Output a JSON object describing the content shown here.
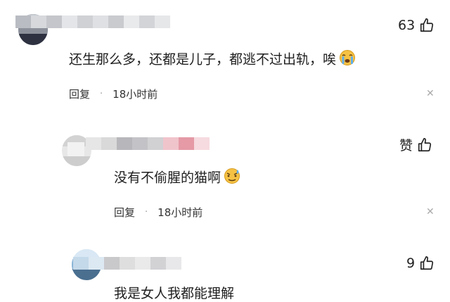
{
  "comments": [
    {
      "like_count": "63",
      "text": "还生那么多，还都是儿子，都逃不过出轨，唉",
      "reply_label": "回复",
      "time": "18小时前",
      "emoji_icon": "crying-face"
    },
    {
      "like_count": "赞",
      "text": "没有不偷腥的猫啊",
      "reply_label": "回复",
      "time": "18小时前",
      "emoji_icon": "sweat-face"
    },
    {
      "like_count": "9",
      "text": "我是女人我都能理解"
    }
  ],
  "dot_separator": "·",
  "more_glyph": "✕",
  "colors": {
    "background": "#ffffff",
    "meta_text": "#333333",
    "more_icon": "#aaaaaa"
  }
}
